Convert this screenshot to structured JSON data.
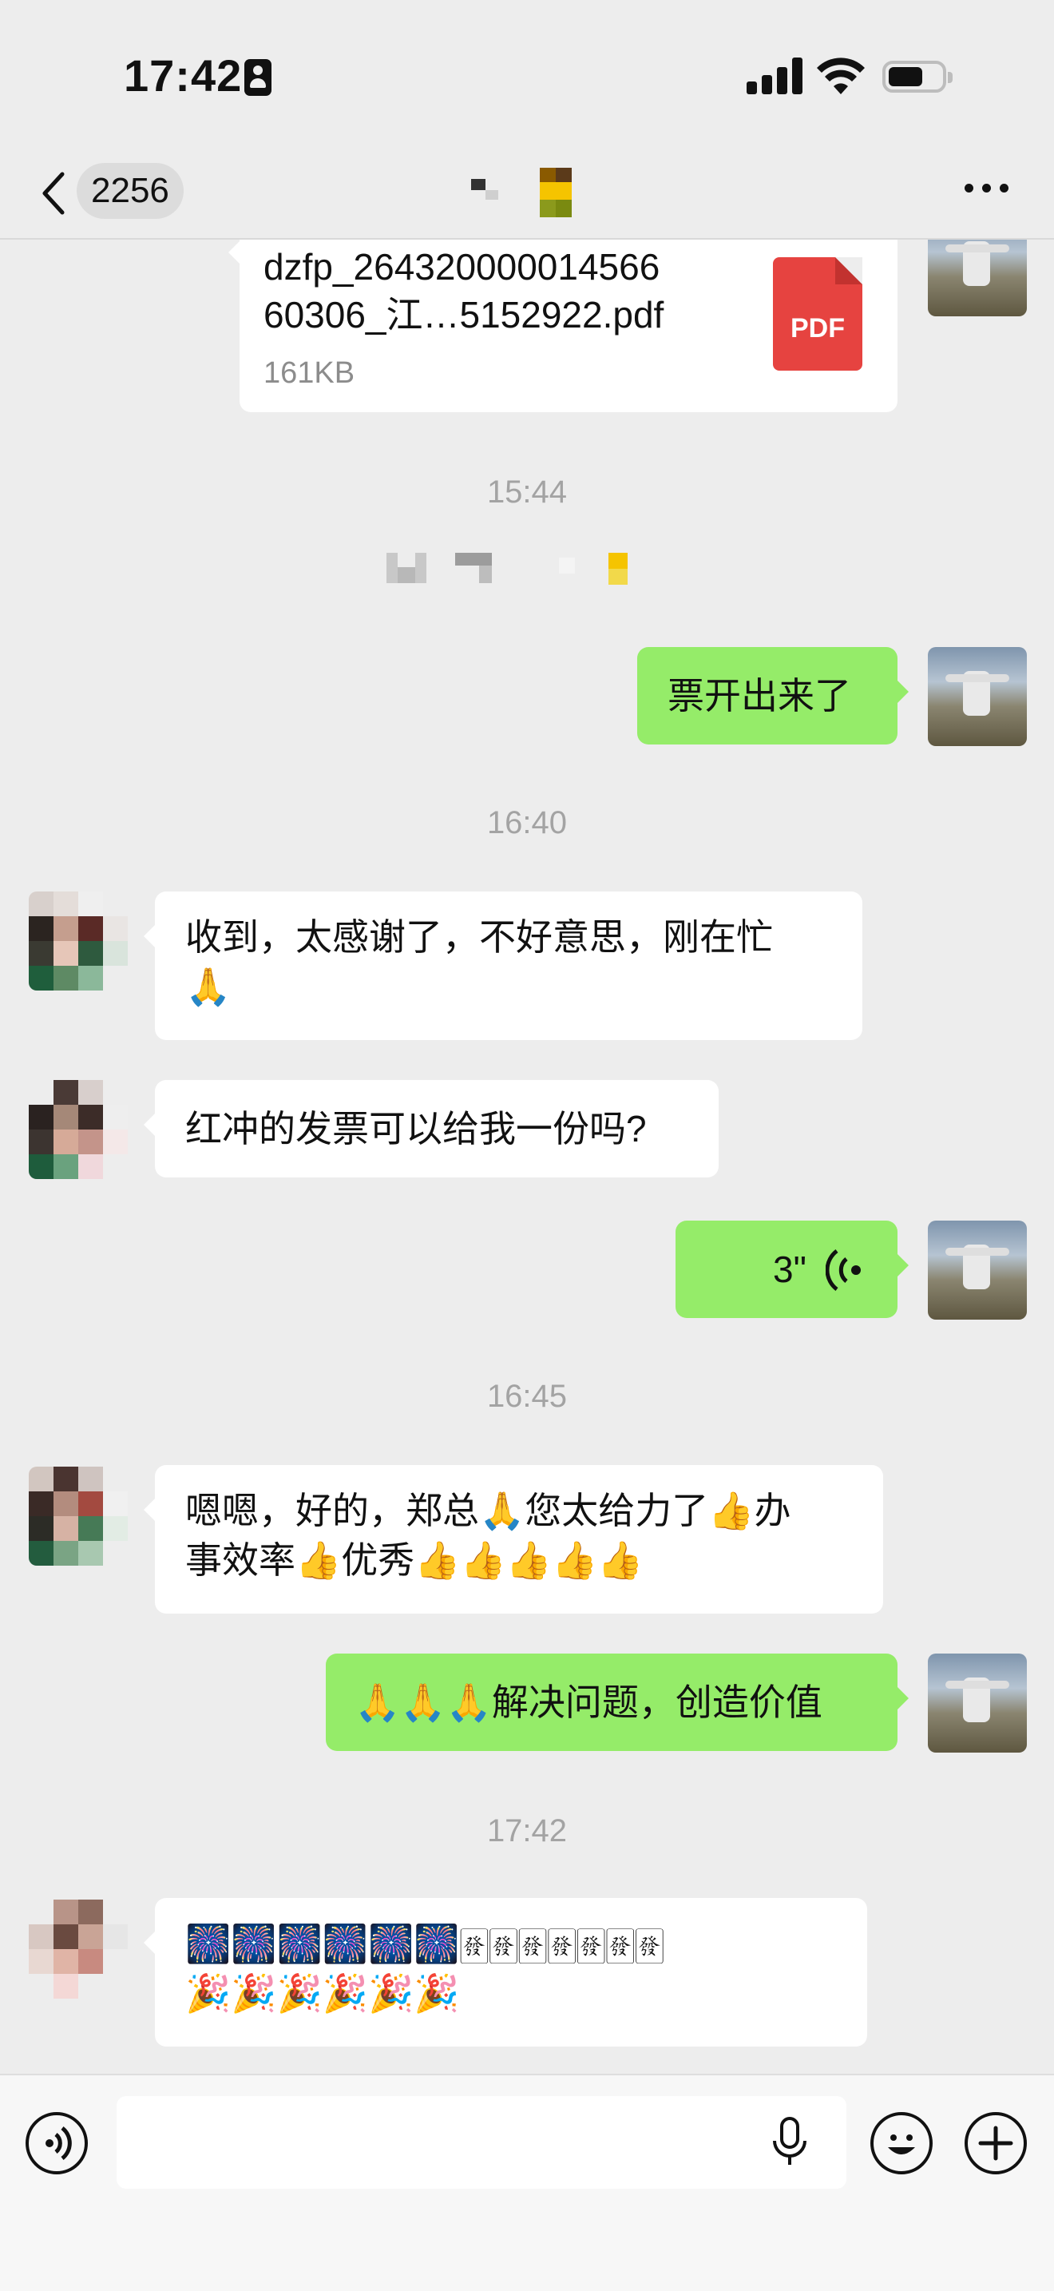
{
  "status_bar": {
    "time": "17:42"
  },
  "nav": {
    "back_count": "2256"
  },
  "messages": {
    "file": {
      "name": "dzfp_26432000001456660306_江…5152922.pdf",
      "name_line1": "dzfp_264320000014566",
      "name_line2": "60306_江…5152922.pdf",
      "size": "161KB",
      "icon_label": "PDF"
    },
    "ts1": "15:44",
    "m1": "票开出来了",
    "ts2": "16:40",
    "m2_line1": "收到，太感谢了，不好意思，刚在忙",
    "m2_line2": "🙏",
    "m3": "红冲的发票可以给我一份吗?",
    "voice": {
      "duration": "3\""
    },
    "ts3": "16:45",
    "m4_line1": "嗯嗯，好的，郑总🙏您太给力了👍办",
    "m4_line2": "事效率👍优秀👍👍👍👍👍",
    "m5": "🙏🙏🙏解决问题，创造价值",
    "ts4": "17:42",
    "m6_line1": "🎆🎆🎆🎆🎆🎆🀅🀅🀅🀅🀅🀅🀅",
    "m6_line2": "🎉🎉🎉🎉🎉🎉"
  },
  "input": {
    "placeholder": ""
  },
  "colors": {
    "background": "#ededed",
    "outgoing_bubble": "#95ec69",
    "incoming_bubble": "#ffffff",
    "pdf_red": "#e64340",
    "timestamp": "#a3a3a3"
  },
  "icons": [
    "back-icon",
    "more-icon",
    "pdf-icon",
    "voice-wave-icon",
    "voice-input-icon",
    "mic-icon",
    "emoji-icon",
    "plus-icon"
  ]
}
